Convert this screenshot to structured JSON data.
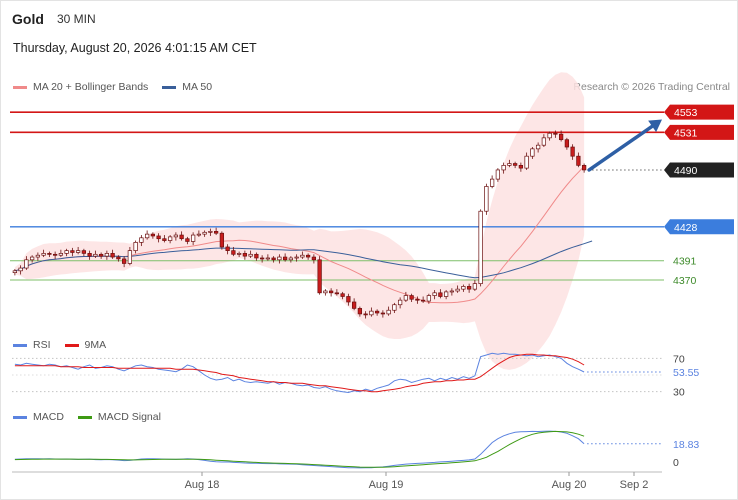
{
  "header": {
    "instrument": "Gold",
    "timeframe": "30 MIN",
    "datetime": "Thursday, August 20, 2026 4:01:15 AM CET"
  },
  "legend_main": [
    {
      "label": "MA 20 + Bollinger Bands",
      "color": "#f08a8a"
    },
    {
      "label": "MA 50",
      "color": "#3a5f9a"
    }
  ],
  "credit": "Research © 2026 Trading Central",
  "legend_rsi": [
    {
      "label": "RSI",
      "color": "#5b83e0"
    },
    {
      "label": "9MA",
      "color": "#e01919"
    }
  ],
  "legend_macd": [
    {
      "label": "MACD",
      "color": "#5b83e0"
    },
    {
      "label": "MACD Signal",
      "color": "#3e9a14"
    }
  ],
  "colors": {
    "resistance": "#d31616",
    "pivot": "#3b7ddd",
    "support": "#7fbf6a",
    "bb_fill": "#fde2e2",
    "up_candle": "#ffffff",
    "down_candle": "#c81d1d",
    "arrow": "#2e5fa5",
    "current_badge": "#222222"
  },
  "chart_data": [
    {
      "type": "candlestick",
      "title": "Gold",
      "x_tick_labels": [
        "Aug 18",
        "Aug 19",
        "Aug 20",
        "Sep 2"
      ],
      "ylim": [
        4310,
        4575
      ],
      "levels": [
        {
          "value": 4553,
          "label": "4553",
          "kind": "resistance"
        },
        {
          "value": 4531,
          "label": "4531",
          "kind": "resistance"
        },
        {
          "value": 4490,
          "label": "4490",
          "kind": "current"
        },
        {
          "value": 4428,
          "label": "4428",
          "kind": "pivot"
        },
        {
          "value": 4391,
          "label": "4391",
          "kind": "support"
        },
        {
          "value": 4370,
          "label": "4370",
          "kind": "support"
        }
      ],
      "close_series": [
        4380,
        4383,
        4392,
        4395,
        4397,
        4399,
        4398,
        4397,
        4399,
        4402,
        4400,
        4402,
        4399,
        4396,
        4398,
        4396,
        4399,
        4395,
        4393,
        4388,
        4402,
        4411,
        4416,
        4420,
        4418,
        4415,
        4413,
        4417,
        4419,
        4415,
        4412,
        4419,
        4420,
        4422,
        4423,
        4421,
        4406,
        4402,
        4398,
        4399,
        4396,
        4398,
        4394,
        4393,
        4394,
        4392,
        4395,
        4392,
        4394,
        4395,
        4397,
        4395,
        4392,
        4356,
        4358,
        4356,
        4355,
        4352,
        4346,
        4339,
        4333,
        4332,
        4336,
        4334,
        4333,
        4337,
        4343,
        4348,
        4353,
        4349,
        4348,
        4347,
        4353,
        4356,
        4352,
        4357,
        4358,
        4360,
        4363,
        4360,
        4366,
        4445,
        4472,
        4480,
        4490,
        4495,
        4497,
        4495,
        4492,
        4505,
        4513,
        4517,
        4525,
        4530,
        4529,
        4523,
        4515,
        4505,
        4495,
        4490
      ],
      "trend_arrow": {
        "from_value": 4490,
        "to_value": 4545
      }
    },
    {
      "type": "line",
      "title": "RSI",
      "ylim": [
        20,
        80
      ],
      "reference_levels": [
        70,
        30
      ],
      "tick_labels": [
        "70",
        "30"
      ],
      "current_value_label": "53.55",
      "series": [
        {
          "name": "RSI",
          "values": [
            63,
            62,
            64,
            63,
            62,
            61,
            63,
            62,
            60,
            61,
            59,
            57,
            60,
            62,
            58,
            59,
            61,
            60,
            57,
            55,
            58,
            61,
            62,
            60,
            59,
            57,
            56,
            55,
            54,
            57,
            62,
            60,
            55,
            50,
            46,
            44,
            45,
            47,
            43,
            45,
            42,
            41,
            42,
            41,
            40,
            42,
            39,
            41,
            40,
            38,
            37,
            38,
            35,
            34,
            36,
            33,
            31,
            30,
            29,
            31,
            30,
            33,
            31,
            34,
            36,
            38,
            43,
            45,
            44,
            41,
            43,
            45,
            46,
            43,
            46,
            44,
            47,
            45,
            48,
            46,
            49,
            72,
            74,
            76,
            75,
            76,
            75,
            75,
            74,
            73,
            74,
            72,
            73,
            74,
            72,
            70,
            64,
            60,
            57,
            53.55
          ]
        },
        {
          "name": "9MA",
          "values": [
            61,
            61,
            61,
            61,
            61,
            61,
            61,
            61,
            60,
            60,
            60,
            60,
            59,
            59,
            59,
            59,
            59,
            59,
            58,
            58,
            58,
            58,
            58,
            58,
            58,
            58,
            58,
            58,
            57,
            57,
            57,
            57,
            56,
            55,
            54,
            53,
            51,
            50,
            49,
            47,
            46,
            45,
            44,
            43,
            42,
            42,
            41,
            41,
            40,
            40,
            40,
            39,
            38,
            37,
            37,
            36,
            35,
            34,
            33,
            32,
            31,
            31,
            30,
            30,
            31,
            32,
            33,
            34,
            36,
            37,
            38,
            40,
            41,
            42,
            42,
            43,
            43,
            44,
            44,
            45,
            45,
            48,
            53,
            58,
            63,
            67,
            71,
            73,
            74,
            75,
            75,
            74,
            74,
            73,
            73,
            72,
            71,
            69,
            66,
            62
          ]
        }
      ]
    },
    {
      "type": "line",
      "title": "MACD",
      "ylim": [
        -8,
        38
      ],
      "tick_labels": [
        "0"
      ],
      "current_value_label": "18.83",
      "series": [
        {
          "name": "MACD",
          "values": [
            3,
            3.2,
            3.5,
            3.6,
            3.5,
            3.3,
            3.4,
            3.2,
            3.1,
            3.2,
            3.0,
            2.8,
            2.9,
            3.1,
            2.6,
            2.5,
            2.7,
            2.4,
            2.1,
            1.6,
            1.8,
            2.5,
            3.2,
            3.5,
            3.4,
            3.3,
            3.1,
            3.0,
            2.8,
            3.1,
            3.4,
            3.2,
            2.6,
            1.8,
            1.0,
            0.4,
            0.2,
            0.3,
            -0.2,
            -0.4,
            -0.8,
            -1.0,
            -1.2,
            -1.4,
            -1.5,
            -1.4,
            -1.8,
            -1.9,
            -2.0,
            -2.2,
            -2.6,
            -3.0,
            -3.4,
            -3.8,
            -4.1,
            -4.5,
            -4.9,
            -5.3,
            -5.6,
            -5.8,
            -5.9,
            -5.7,
            -5.6,
            -5.2,
            -4.8,
            -4.1,
            -3.3,
            -2.6,
            -2.0,
            -1.7,
            -1.3,
            -0.9,
            -0.5,
            -0.2,
            0.3,
            0.6,
            1.0,
            1.4,
            1.8,
            2.3,
            3.2,
            8,
            14,
            20,
            24,
            27,
            29,
            30.5,
            31,
            31.3,
            31.5,
            31.4,
            31.6,
            31.8,
            31.5,
            30.8,
            29.5,
            27,
            24,
            18.83
          ]
        },
        {
          "name": "MACD Signal",
          "values": [
            2.6,
            2.7,
            2.8,
            2.9,
            3.0,
            3.1,
            3.1,
            3.1,
            3.1,
            3.1,
            3.1,
            3.0,
            3.0,
            3.0,
            2.9,
            2.8,
            2.8,
            2.7,
            2.6,
            2.4,
            2.3,
            2.3,
            2.4,
            2.6,
            2.7,
            2.8,
            2.9,
            2.9,
            2.9,
            2.9,
            3.0,
            3.0,
            2.9,
            2.7,
            2.4,
            2.0,
            1.7,
            1.4,
            1.0,
            0.7,
            0.4,
            0.1,
            -0.2,
            -0.5,
            -0.7,
            -0.9,
            -1.1,
            -1.3,
            -1.5,
            -1.7,
            -1.9,
            -2.2,
            -2.5,
            -2.8,
            -3.1,
            -3.4,
            -3.8,
            -4.1,
            -4.4,
            -4.7,
            -5.0,
            -5.1,
            -5.2,
            -5.2,
            -5.1,
            -4.9,
            -4.6,
            -4.2,
            -3.8,
            -3.4,
            -3.0,
            -2.6,
            -2.2,
            -1.8,
            -1.4,
            -1.0,
            -0.6,
            -0.2,
            0.3,
            0.8,
            1.4,
            3,
            5,
            8,
            11,
            14.5,
            18,
            21,
            24,
            26.5,
            28.5,
            29.8,
            30.6,
            31.2,
            31.5,
            31.3,
            30.9,
            30.0,
            28.6,
            26.6
          ]
        }
      ]
    }
  ]
}
